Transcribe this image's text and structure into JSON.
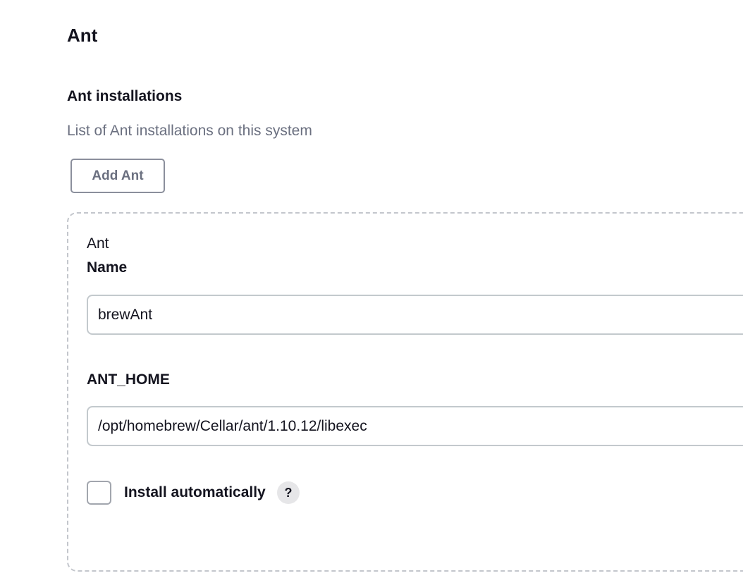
{
  "section": {
    "title": "Ant"
  },
  "installations": {
    "title": "Ant installations",
    "description": "List of Ant installations on this system",
    "add_button_label": "Add Ant"
  },
  "entry": {
    "header": "Ant",
    "name_label": "Name",
    "name_value": "brewAnt",
    "home_label": "ANT_HOME",
    "home_value": "/opt/homebrew/Cellar/ant/1.10.12/libexec",
    "install_auto_label": "Install automatically",
    "install_auto_checked": false,
    "help_glyph": "?",
    "help_icon": "question-mark-icon"
  }
}
